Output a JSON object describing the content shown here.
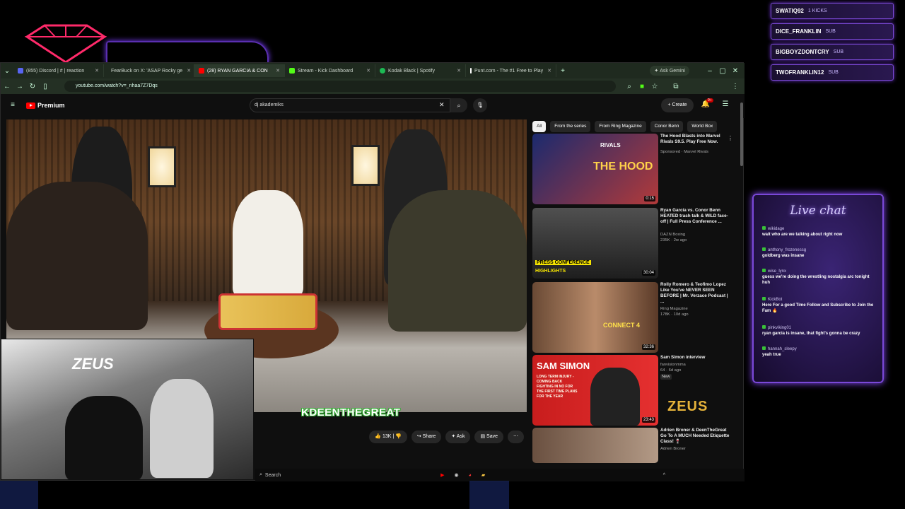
{
  "alerts": [
    {
      "name": "SWATIQ92",
      "type": "1 KICKS"
    },
    {
      "name": "DICE_FRANKLIN",
      "type": "SUB"
    },
    {
      "name": "BIGBOYZDONTCRY",
      "type": "SUB"
    },
    {
      "name": "TWOFRANKLIN12",
      "type": "SUB"
    }
  ],
  "browser": {
    "tabs": [
      {
        "label": "(855) Discord | #  |  reaction",
        "color": "#5865f2",
        "active": false
      },
      {
        "label": "FearBuck on X: 'ASAP Rocky ge",
        "color": "#ffffff",
        "active": false
      },
      {
        "label": "(28) RYAN GARCIA & CON",
        "color": "#ff0000",
        "active": true
      },
      {
        "label": "Stream - Kick Dashboard",
        "color": "#53fc18",
        "active": false
      },
      {
        "label": "Kodak Black | Spotify",
        "color": "#1db954",
        "active": false
      },
      {
        "label": "Punt.com - The #1 Free to Play",
        "color": "#ffffff",
        "active": false
      }
    ],
    "ask_gemini": "Ask Gemini",
    "url": "youtube.com/watch?v=_nhaa7Z7Dqs"
  },
  "youtube": {
    "premium_label": "Premium",
    "search_value": "dj akademiks",
    "create_label": "Create",
    "notif_count": "9+",
    "actions": {
      "likes": "13K",
      "share": "Share",
      "ask": "Ask",
      "save": "Save"
    },
    "chips": [
      "All",
      "From the series",
      "From Ring Magazine",
      "Conor Benn",
      "World Box"
    ],
    "recommendations": [
      {
        "title": "The Hood Blasts into Marvel Rivals S9.5. Play Free Now.",
        "meta1": "Sponsored · Marvel Rivals",
        "meta2": "",
        "duration": "0:15",
        "thumb_text": "THE HOOD",
        "thumb_sub": "RIVALS"
      },
      {
        "title": "Ryan Garcia vs. Conor Benn HEATED trash talk & WILD face-off | Full Press Conference ...",
        "meta1": "DAZN Boxing",
        "meta2": "235K · 2w ago",
        "duration": "30:04",
        "thumb_text": "PRESS CONFERENCE",
        "thumb_sub": "HIGHLIGHTS"
      },
      {
        "title": "Rolly Romero & Teofimo Lopez Like You've NEVER SEEN BEFORE | Mr. Verzace Podcast | ...",
        "meta1": "Ring Magazine",
        "meta2": "178K · 10d ago",
        "duration": "32:36",
        "thumb_text": "CONNECT 4",
        "thumb_sub": ""
      },
      {
        "title": "Sam Simon interview",
        "meta1": "fanvisionmma",
        "meta2": "64 · 6d ago",
        "badge": "New",
        "duration": "23:43",
        "thumb_text": "SAM SIMON",
        "thumb_sub": "LONG TERM INJURY - COMING BACK  FIGHTING IN NO FOR THE FIRST TIME  PLANS FOR THE YEAR"
      },
      {
        "title": "Adrien Broner & DeenTheGreat Go To A MUCH Needed Etiquette Class! 🍷",
        "meta1": "Adrien Broner",
        "meta2": "",
        "duration": "",
        "thumb_text": "",
        "thumb_sub": ""
      }
    ]
  },
  "taskbar": {
    "search": "Search",
    "streamer": "KDEENTHEGREAT",
    "brand": "ZEUS"
  },
  "chat": {
    "title": "Live chat",
    "messages": [
      {
        "user": "wikidage",
        "text": "wait who are we talking about right now"
      },
      {
        "user": "anthony_frozenessg",
        "text": "goldberg was insane"
      },
      {
        "user": "wise_lynx",
        "text": "guess we're doing the wrestling nostalgia arc tonight huh"
      },
      {
        "user": "KickBot",
        "text": "Here For a good Time Follow and Subscribe to Join the Fam 🔥"
      },
      {
        "user": "pinkviking01",
        "text": "ryan garcia is insane, that fight's gonna be crazy"
      },
      {
        "user": "hannah_sleepy",
        "text": "yeah true"
      }
    ]
  },
  "colors": {
    "accent": "#7a48d8",
    "yt_red": "#ff0000",
    "kick_green": "#53fc18"
  }
}
